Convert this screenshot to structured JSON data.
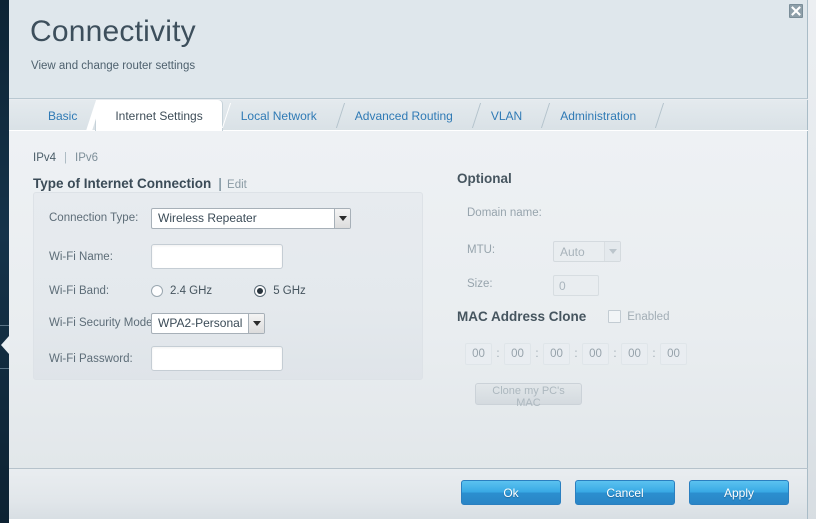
{
  "window": {
    "close_label": "Close",
    "close_icon": "close-icon"
  },
  "header": {
    "title": "Connectivity",
    "subtitle": "View and change router settings"
  },
  "tabs": [
    {
      "label": "Basic",
      "active": false
    },
    {
      "label": "Internet Settings",
      "active": true
    },
    {
      "label": "Local Network",
      "active": false
    },
    {
      "label": "Advanced Routing",
      "active": false
    },
    {
      "label": "VLAN",
      "active": false
    },
    {
      "label": "Administration",
      "active": false
    }
  ],
  "ip_links": {
    "ipv4": "IPv4",
    "separator": "|",
    "ipv6": "IPv6"
  },
  "connection_section": {
    "title": "Type of Internet Connection",
    "separator": "|",
    "edit_label": "Edit",
    "fields": {
      "connection_type": {
        "label": "Connection Type:",
        "value": "Wireless Repeater",
        "options": [
          "Wireless Repeater"
        ]
      },
      "wifi_name": {
        "label": "Wi-Fi Name:",
        "value": "",
        "placeholder": ""
      },
      "wifi_band": {
        "label": "Wi-Fi Band:",
        "options": [
          {
            "label": "2.4 GHz",
            "selected": false
          },
          {
            "label": "5 GHz",
            "selected": true
          }
        ]
      },
      "wifi_security_mode": {
        "label": "Wi-Fi Security Mode:",
        "value": "WPA2-Personal",
        "options": [
          "WPA2-Personal"
        ]
      },
      "wifi_password": {
        "label": "Wi-Fi Password:",
        "value": "",
        "placeholder": ""
      }
    }
  },
  "optional_section": {
    "title": "Optional",
    "fields": {
      "domain_name": {
        "label": "Domain name:",
        "value": ""
      },
      "mtu": {
        "label": "MTU:",
        "value": "Auto",
        "options": [
          "Auto"
        ]
      },
      "size": {
        "label": "Size:",
        "value": "0"
      }
    }
  },
  "mac_clone_section": {
    "title": "MAC Address Clone",
    "enabled_label": "Enabled",
    "enabled": false,
    "octets": [
      "00",
      "00",
      "00",
      "00",
      "00",
      "00"
    ],
    "octet_separator": ":",
    "clone_button_label": "Clone my PC's MAC"
  },
  "footer": {
    "ok_label": "Ok",
    "cancel_label": "Cancel",
    "apply_label": "Apply"
  },
  "colors": {
    "accent_blue": "#2f7ab5",
    "button_blue": "#38a9e4",
    "header_bg": "#dfe7ec",
    "rail_navy": "#15334a",
    "text_dark": "#3b4b57",
    "text_muted": "#97a4ad"
  }
}
